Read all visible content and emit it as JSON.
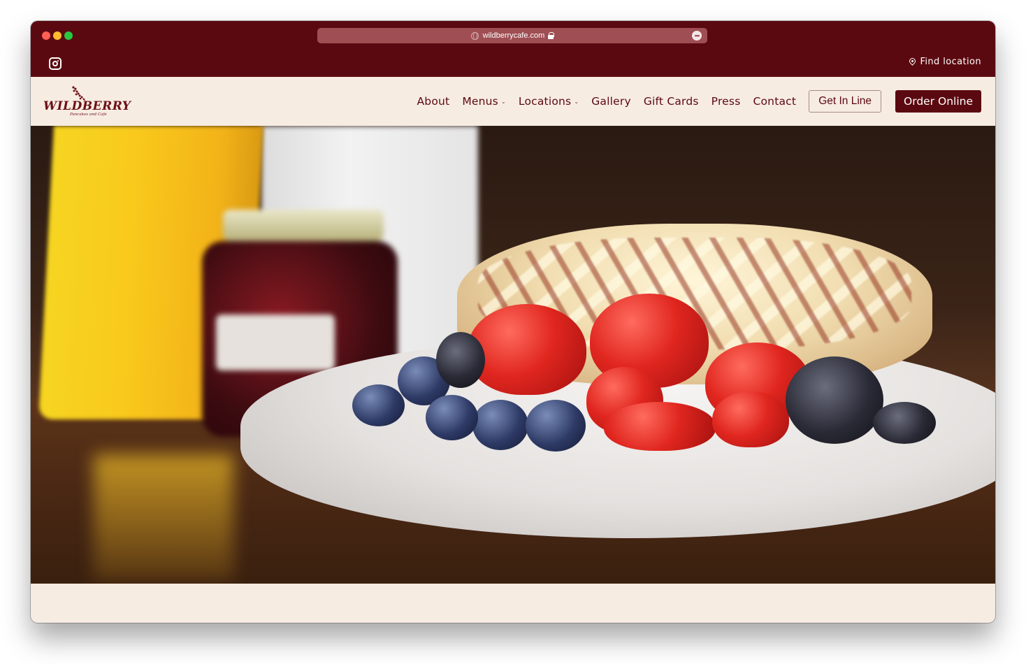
{
  "browser": {
    "url": "wildberrycafe.com",
    "traffic_lights": [
      "close",
      "minimize",
      "zoom"
    ],
    "more_icon": "ellipsis-icon",
    "lock_icon": "lock-icon",
    "site_icon": "globe-icon"
  },
  "topbar": {
    "social_icon": "instagram-icon",
    "find_location_label": "Find location",
    "find_location_icon": "map-pin-icon"
  },
  "header": {
    "logo": {
      "name": "WILDBERRY",
      "tagline": "Pancakes and Cafe"
    },
    "nav": [
      {
        "label": "About",
        "has_dropdown": false
      },
      {
        "label": "Menus",
        "has_dropdown": true
      },
      {
        "label": "Locations",
        "has_dropdown": true
      },
      {
        "label": "Gallery",
        "has_dropdown": false
      },
      {
        "label": "Gift Cards",
        "has_dropdown": false
      },
      {
        "label": "Press",
        "has_dropdown": false
      },
      {
        "label": "Contact",
        "has_dropdown": false
      }
    ],
    "dropdown_glyph": "⌄",
    "get_in_line_label": "Get In Line",
    "order_online_label": "Order Online"
  },
  "hero": {
    "alt": "Stack of pancakes with drizzle, strawberries, blueberries and blackberries, orange juice and jam jar"
  },
  "colors": {
    "brand": "#5b0910",
    "cream": "#f7ece2",
    "url_bar": "#9f4e53"
  }
}
